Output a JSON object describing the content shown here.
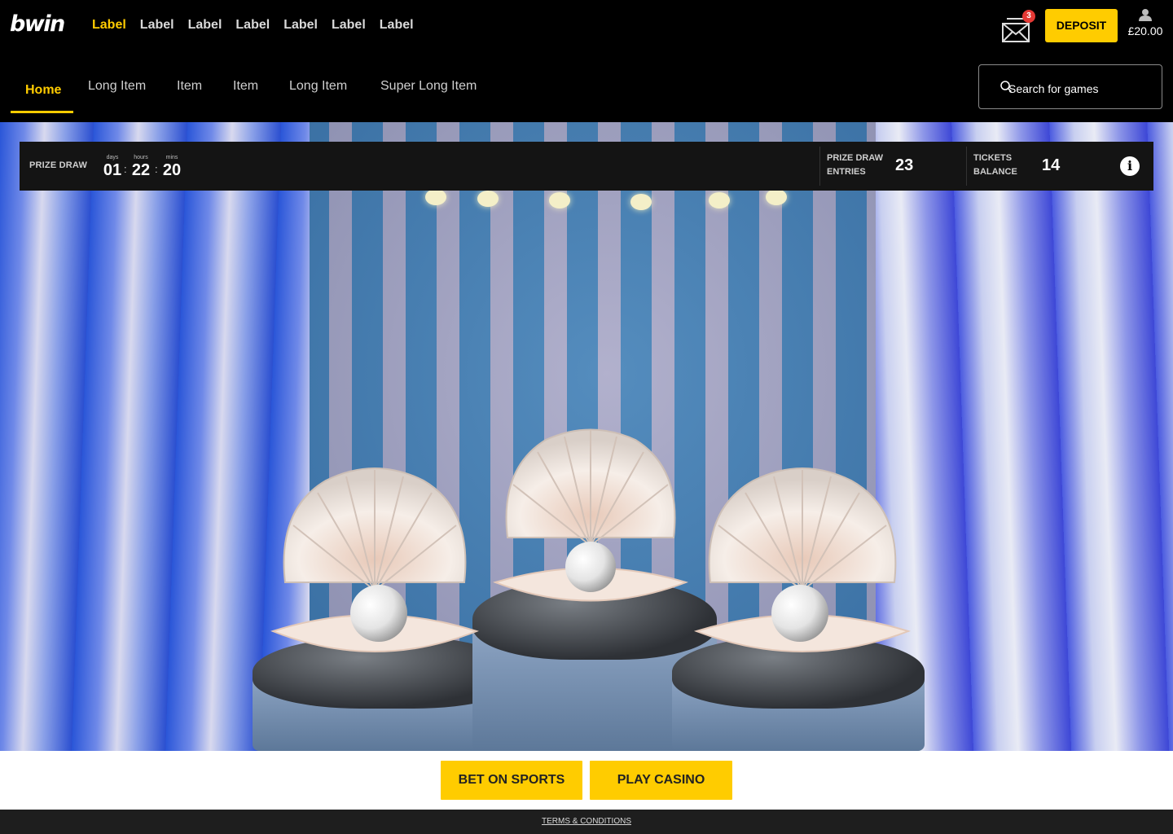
{
  "brand": {
    "logo": "bwin"
  },
  "main_nav": [
    "Label",
    "Label",
    "Label",
    "Label",
    "Label",
    "Label",
    "Label"
  ],
  "header": {
    "mail_badge": "3",
    "deposit_label": "DEPOSIT",
    "balance": "£20.00",
    "icons": [
      "mail-icon",
      "user-icon",
      "search-icon",
      "info-icon"
    ]
  },
  "sub_nav": [
    "Home",
    "Long Item",
    "Item",
    "Item",
    "Long Item",
    "Super Long Item"
  ],
  "search": {
    "placeholder": "Search for games"
  },
  "prize_draw": {
    "label": "PRIZE DRAW",
    "countdown": {
      "days_label": "days",
      "days": "01",
      "hours_label": "hours",
      "hours": "22",
      "mins_label": "mins",
      "mins": "20",
      "separator": ":"
    },
    "entries_label_1": "PRIZE DRAW",
    "entries_label_2": "ENTRIES",
    "entries": "23",
    "tickets_label_1": "TICKETS",
    "tickets_label_2": "BALANCE",
    "tickets": "14",
    "info_symbol": "i"
  },
  "cta": {
    "sports": "BET ON SPORTS",
    "casino": "PLAY CASINO"
  },
  "footer": {
    "terms": "TERMS & CONDITIONS"
  },
  "colors": {
    "accent": "#ffcc00",
    "background": "#000000",
    "badge": "#e53935"
  }
}
